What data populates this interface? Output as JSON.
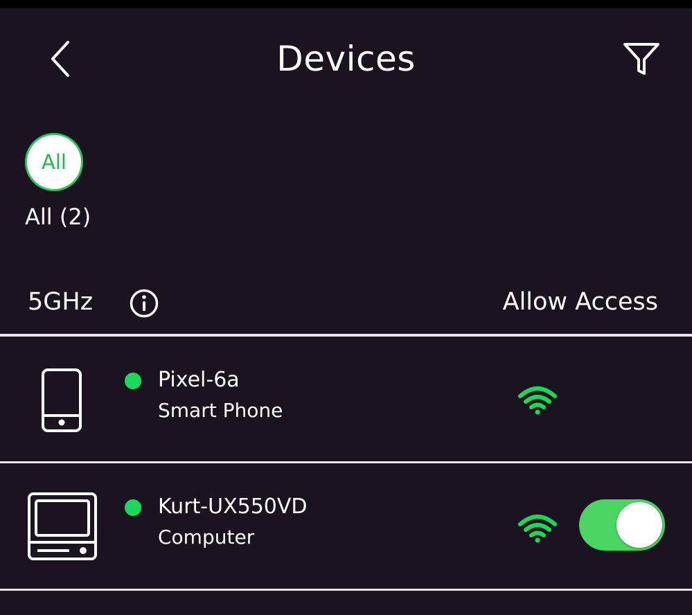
{
  "header": {
    "title": "Devices",
    "back_icon": "chevron-left-icon",
    "filter_icon": "filter-funnel-icon"
  },
  "categories": [
    {
      "chip_label": "All",
      "label": "All (2)",
      "selected": true
    }
  ],
  "band": {
    "label": "5GHz",
    "info_icon": "info-icon",
    "allow_access_label": "Allow Access"
  },
  "devices": [
    {
      "name": "Pixel-6a",
      "type": "Smart Phone",
      "icon": "smartphone-icon",
      "online": true,
      "signal_icon": "wifi-signal-icon",
      "allow_access_toggle": null
    },
    {
      "name": "Kurt-UX550VD",
      "type": "Computer",
      "icon": "computer-icon",
      "online": true,
      "signal_icon": "wifi-signal-icon",
      "allow_access_toggle": true
    }
  ],
  "colors": {
    "background": "#1c1320",
    "accent_green": "#1fb852",
    "online_dot": "#1ad85a",
    "toggle_on": "#4bd563",
    "divider": "#e8e6ea"
  }
}
